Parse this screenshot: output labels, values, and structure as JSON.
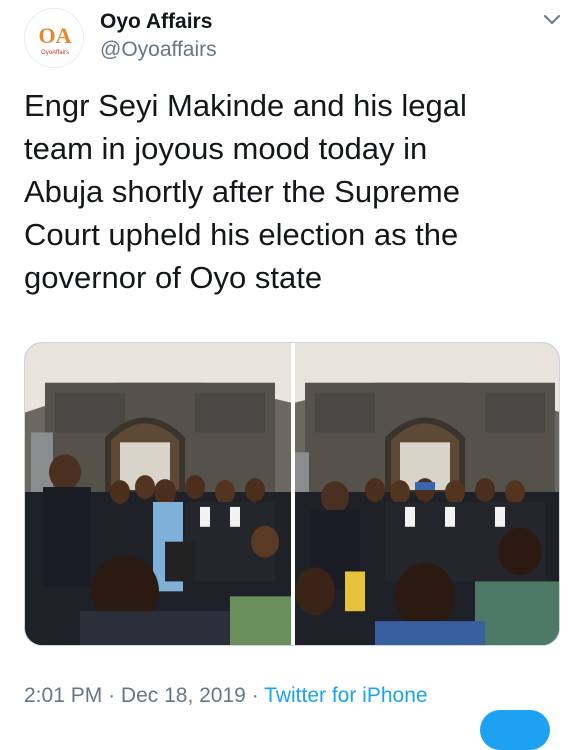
{
  "account": {
    "name": "Oyo Affairs",
    "handle": "@Oyoaffairs",
    "avatar_logo_text": "OyoAffairs"
  },
  "tweet": {
    "text_lines": [
      "Engr Seyi Makinde and his legal",
      "team in joyous mood today in",
      "Abuja shortly after the Supreme",
      "Court upheld his election as the",
      "governor of Oyo state"
    ]
  },
  "meta": {
    "time": "2:01 PM",
    "separator": "·",
    "date": "Dec 18, 2019",
    "source": "Twitter for iPhone"
  },
  "icons": {
    "menu": "chevron-down-icon"
  },
  "colors": {
    "accent": "#1da1f2",
    "secondary_text": "#657786",
    "primary_text": "#14171a"
  }
}
